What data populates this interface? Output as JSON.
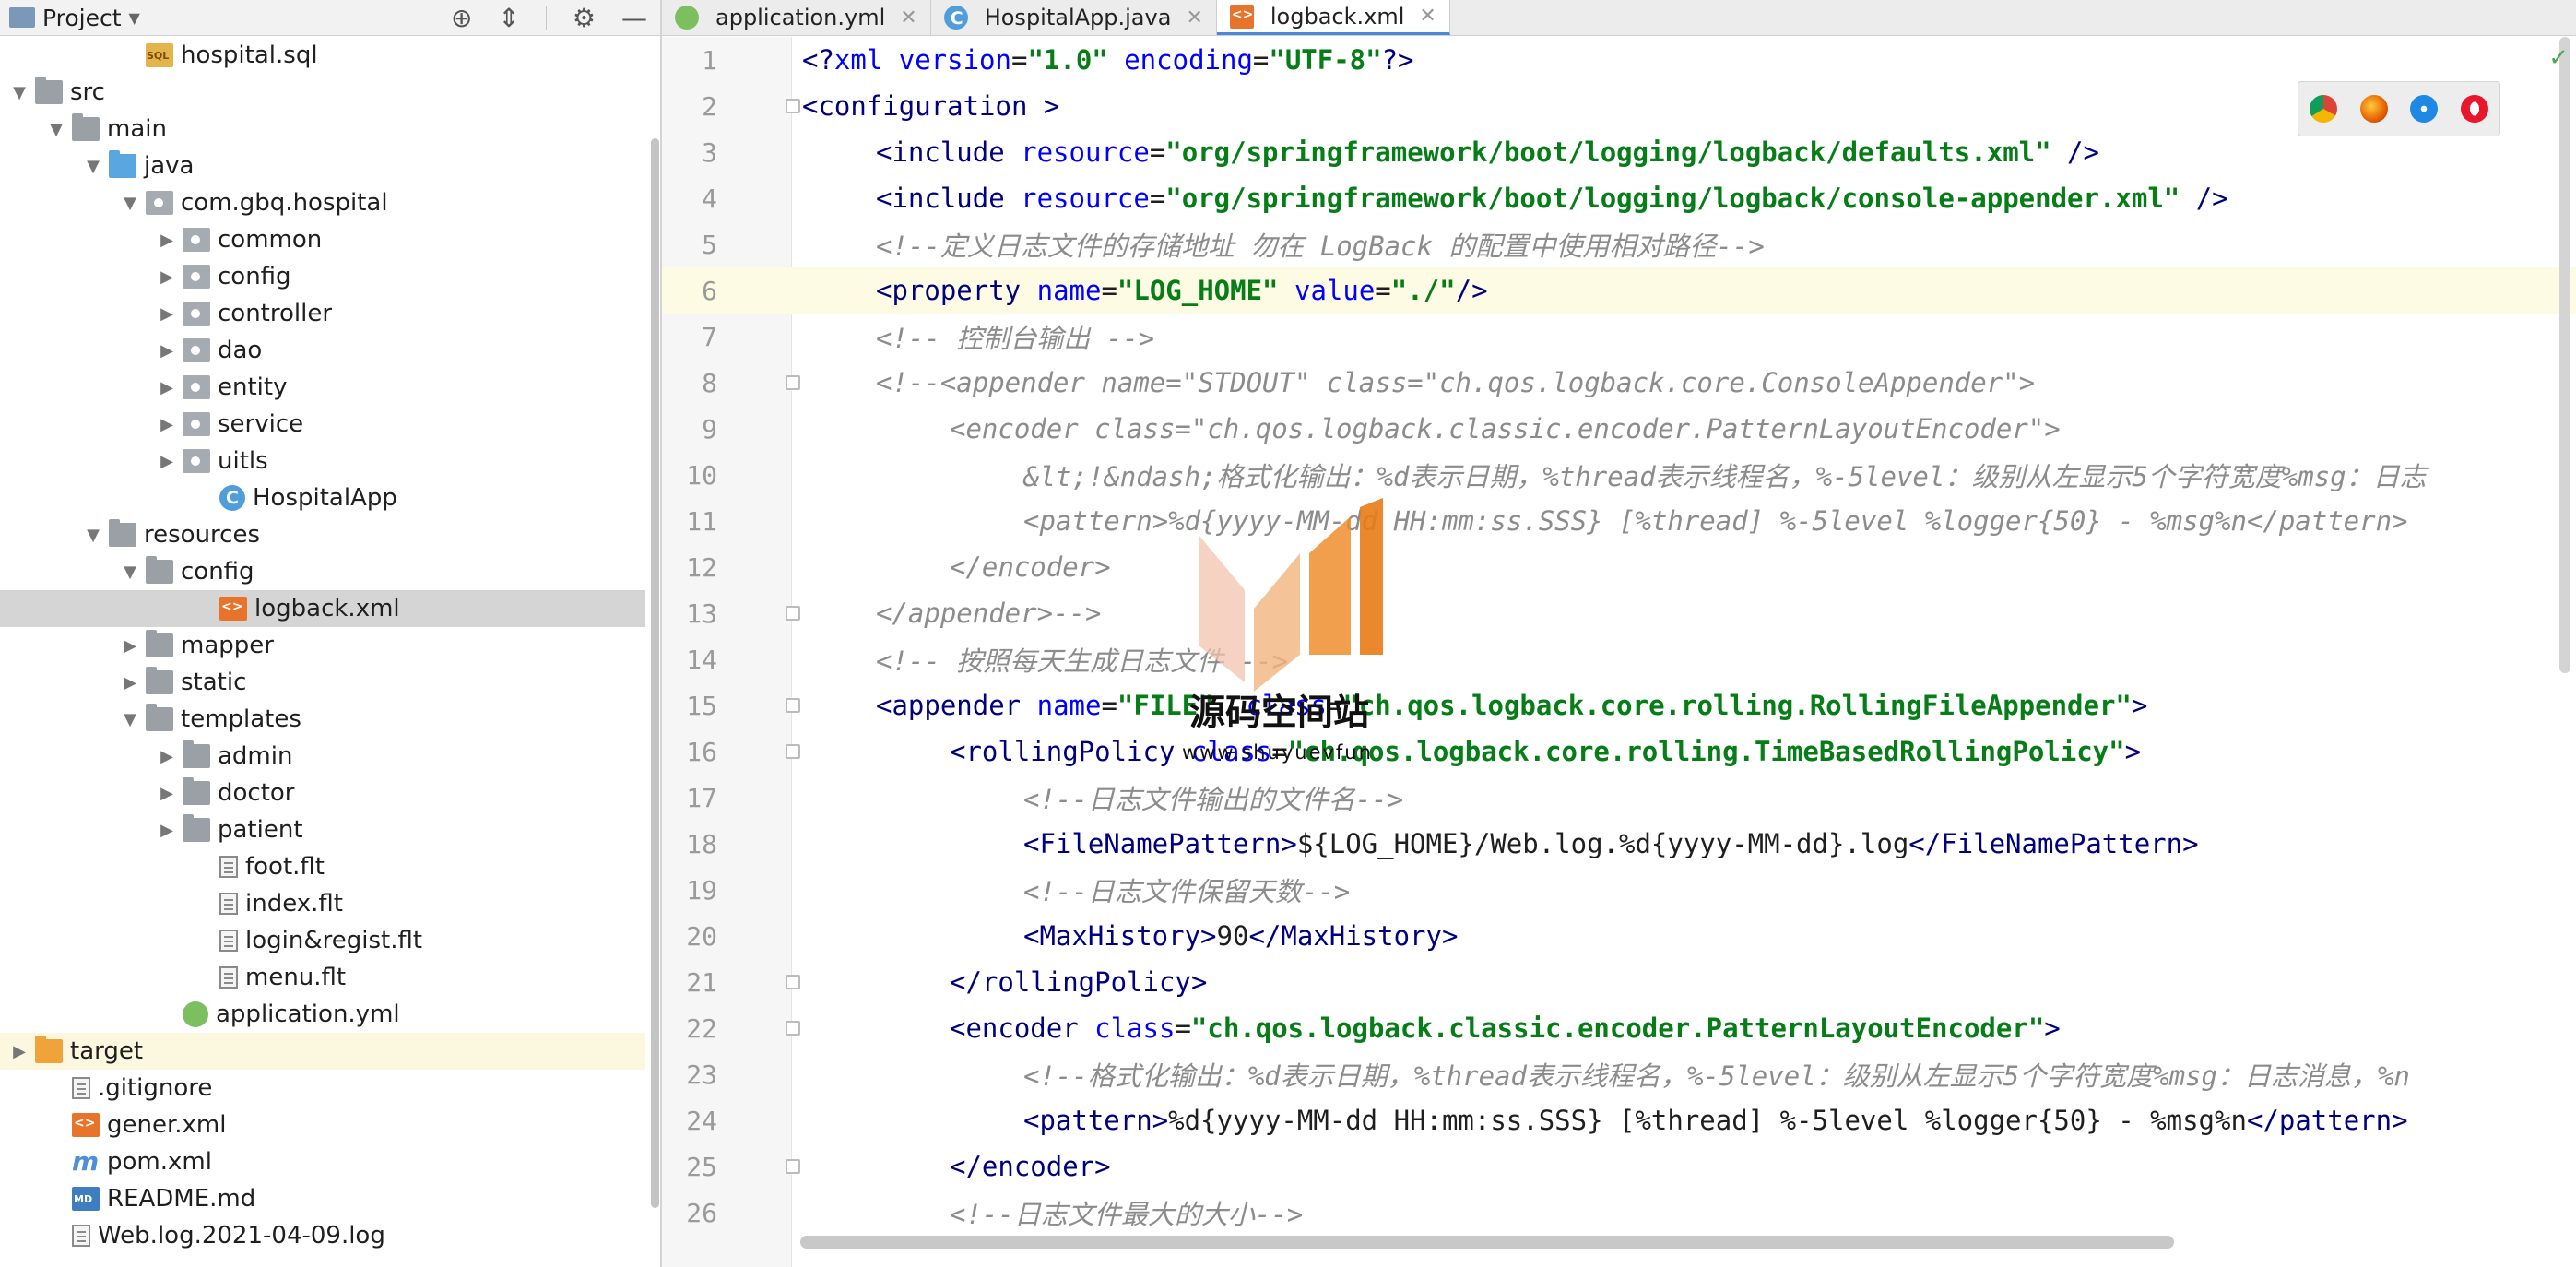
{
  "project_panel": {
    "title": "Project",
    "tools": {
      "globe": "globe-icon",
      "collapse": "collapse-icon",
      "gear": "gear-icon",
      "minimize": "minimize-icon"
    }
  },
  "tree": [
    {
      "label": "hospital.sql",
      "icon": "sql",
      "depth": 4,
      "arrow": ""
    },
    {
      "label": "src",
      "icon": "folder",
      "depth": 1,
      "arrow": "▼"
    },
    {
      "label": "main",
      "icon": "folder",
      "depth": 2,
      "arrow": "▼"
    },
    {
      "label": "java",
      "icon": "folder-blue",
      "depth": 3,
      "arrow": "▼"
    },
    {
      "label": "com.gbq.hospital",
      "icon": "pkg",
      "depth": 4,
      "arrow": "▼"
    },
    {
      "label": "common",
      "icon": "pkg",
      "depth": 5,
      "arrow": "▶"
    },
    {
      "label": "config",
      "icon": "pkg",
      "depth": 5,
      "arrow": "▶"
    },
    {
      "label": "controller",
      "icon": "pkg",
      "depth": 5,
      "arrow": "▶"
    },
    {
      "label": "dao",
      "icon": "pkg",
      "depth": 5,
      "arrow": "▶"
    },
    {
      "label": "entity",
      "icon": "pkg",
      "depth": 5,
      "arrow": "▶"
    },
    {
      "label": "service",
      "icon": "pkg",
      "depth": 5,
      "arrow": "▶"
    },
    {
      "label": "uitls",
      "icon": "pkg",
      "depth": 5,
      "arrow": "▶"
    },
    {
      "label": "HospitalApp",
      "icon": "java",
      "depth": 6,
      "arrow": ""
    },
    {
      "label": "resources",
      "icon": "folder",
      "depth": 3,
      "arrow": "▼"
    },
    {
      "label": "config",
      "icon": "folder",
      "depth": 4,
      "arrow": "▼"
    },
    {
      "label": "logback.xml",
      "icon": "xml",
      "depth": 6,
      "arrow": "",
      "selected": true
    },
    {
      "label": "mapper",
      "icon": "folder",
      "depth": 4,
      "arrow": "▶"
    },
    {
      "label": "static",
      "icon": "folder",
      "depth": 4,
      "arrow": "▶"
    },
    {
      "label": "templates",
      "icon": "folder",
      "depth": 4,
      "arrow": "▼"
    },
    {
      "label": "admin",
      "icon": "folder",
      "depth": 5,
      "arrow": "▶"
    },
    {
      "label": "doctor",
      "icon": "folder",
      "depth": 5,
      "arrow": "▶"
    },
    {
      "label": "patient",
      "icon": "folder",
      "depth": 5,
      "arrow": "▶"
    },
    {
      "label": "foot.flt",
      "icon": "file",
      "depth": 6,
      "arrow": ""
    },
    {
      "label": "index.flt",
      "icon": "file",
      "depth": 6,
      "arrow": ""
    },
    {
      "label": "login&regist.flt",
      "icon": "file",
      "depth": 6,
      "arrow": ""
    },
    {
      "label": "menu.flt",
      "icon": "file",
      "depth": 6,
      "arrow": ""
    },
    {
      "label": "application.yml",
      "icon": "yml",
      "depth": 5,
      "arrow": ""
    },
    {
      "label": "target",
      "icon": "folder-orange",
      "depth": 1,
      "arrow": "▶",
      "highlight": true
    },
    {
      "label": ".gitignore",
      "icon": "file",
      "depth": 2,
      "arrow": ""
    },
    {
      "label": "gener.xml",
      "icon": "xml",
      "depth": 2,
      "arrow": ""
    },
    {
      "label": "pom.xml",
      "icon": "maven",
      "depth": 2,
      "arrow": ""
    },
    {
      "label": "README.md",
      "icon": "md",
      "depth": 2,
      "arrow": ""
    },
    {
      "label": "Web.log.2021-04-09.log",
      "icon": "file",
      "depth": 2,
      "arrow": ""
    }
  ],
  "tabs": [
    {
      "label": "application.yml",
      "icon": "yml",
      "active": false
    },
    {
      "label": "HospitalApp.java",
      "icon": "java",
      "active": false
    },
    {
      "label": "logback.xml",
      "icon": "xml",
      "active": true
    }
  ],
  "editor": {
    "current_line": 6,
    "lines": [
      {
        "n": "1",
        "indent": 0,
        "fold": false,
        "parts": [
          [
            "tag",
            "<?"
          ],
          [
            "attr",
            "xml version"
          ],
          [
            "plain",
            "="
          ],
          [
            "val",
            "\"1.0\""
          ],
          [
            "attr",
            " encoding"
          ],
          [
            "plain",
            "="
          ],
          [
            "val",
            "\"UTF-8\""
          ],
          [
            "tag",
            "?>"
          ]
        ]
      },
      {
        "n": "2",
        "indent": 0,
        "fold": true,
        "parts": [
          [
            "tag",
            "<configuration "
          ],
          [
            "tag",
            ">"
          ]
        ]
      },
      {
        "n": "3",
        "indent": 1,
        "fold": false,
        "parts": [
          [
            "tag",
            "<include "
          ],
          [
            "attr",
            "resource"
          ],
          [
            "plain",
            "="
          ],
          [
            "val",
            "\"org/springframework/boot/logging/logback/defaults.xml\""
          ],
          [
            "tag",
            " />"
          ]
        ]
      },
      {
        "n": "4",
        "indent": 1,
        "fold": false,
        "parts": [
          [
            "tag",
            "<include "
          ],
          [
            "attr",
            "resource"
          ],
          [
            "plain",
            "="
          ],
          [
            "val",
            "\"org/springframework/boot/logging/logback/console-appender.xml\""
          ],
          [
            "tag",
            " />"
          ]
        ]
      },
      {
        "n": "5",
        "indent": 1,
        "fold": false,
        "parts": [
          [
            "cmt",
            "<!--定义日志文件的存储地址 勿在 LogBack 的配置中使用相对路径-->"
          ]
        ]
      },
      {
        "n": "6",
        "indent": 1,
        "fold": false,
        "parts": [
          [
            "tag",
            "<property "
          ],
          [
            "attr",
            "name"
          ],
          [
            "plain",
            "="
          ],
          [
            "val",
            "\"LOG_HOME\""
          ],
          [
            "attr",
            " value"
          ],
          [
            "plain",
            "="
          ],
          [
            "val",
            "\"./\""
          ],
          [
            "tag",
            "/>"
          ]
        ]
      },
      {
        "n": "7",
        "indent": 1,
        "fold": false,
        "parts": [
          [
            "cmt",
            "<!-- 控制台输出 -->"
          ]
        ]
      },
      {
        "n": "8",
        "indent": 1,
        "fold": true,
        "parts": [
          [
            "cmt",
            "<!--<appender name=\"STDOUT\" class=\"ch.qos.logback.core.ConsoleAppender\">"
          ]
        ]
      },
      {
        "n": "9",
        "indent": 2,
        "fold": false,
        "parts": [
          [
            "cmt",
            "<encoder class=\"ch.qos.logback.classic.encoder.PatternLayoutEncoder\">"
          ]
        ]
      },
      {
        "n": "10",
        "indent": 3,
        "fold": false,
        "parts": [
          [
            "cmt",
            "&lt;!&ndash;格式化输出：%d表示日期，%thread表示线程名，%-5level：级别从左显示5个字符宽度%msg：日志"
          ]
        ]
      },
      {
        "n": "11",
        "indent": 3,
        "fold": false,
        "parts": [
          [
            "cmt",
            "<pattern>%d{yyyy-MM-dd HH:mm:ss.SSS} [%thread] %-5level %logger{50} - %msg%n</pattern>"
          ]
        ]
      },
      {
        "n": "12",
        "indent": 2,
        "fold": false,
        "parts": [
          [
            "cmt",
            "</encoder>"
          ]
        ]
      },
      {
        "n": "13",
        "indent": 1,
        "fold": true,
        "parts": [
          [
            "cmt",
            "</appender>-->"
          ]
        ]
      },
      {
        "n": "14",
        "indent": 1,
        "fold": false,
        "parts": [
          [
            "cmt",
            "<!-- 按照每天生成日志文件 -->"
          ]
        ]
      },
      {
        "n": "15",
        "indent": 1,
        "fold": true,
        "parts": [
          [
            "tag",
            "<appender "
          ],
          [
            "attr",
            "name"
          ],
          [
            "plain",
            "="
          ],
          [
            "val",
            "\"FILE\""
          ],
          [
            "attr",
            "  class"
          ],
          [
            "plain",
            "="
          ],
          [
            "val",
            "\"ch.qos.logback.core.rolling.RollingFileAppender\""
          ],
          [
            "tag",
            ">"
          ]
        ]
      },
      {
        "n": "16",
        "indent": 2,
        "fold": true,
        "parts": [
          [
            "tag",
            "<rollingPolicy "
          ],
          [
            "attr",
            "class"
          ],
          [
            "plain",
            "="
          ],
          [
            "val",
            "\"ch.qos.logback.core.rolling.TimeBasedRollingPolicy\""
          ],
          [
            "tag",
            ">"
          ]
        ]
      },
      {
        "n": "17",
        "indent": 3,
        "fold": false,
        "parts": [
          [
            "cmt",
            "<!--日志文件输出的文件名-->"
          ]
        ]
      },
      {
        "n": "18",
        "indent": 3,
        "fold": false,
        "parts": [
          [
            "tag",
            "<FileNamePattern>"
          ],
          [
            "plain",
            "${LOG_HOME}/Web.log.%d{yyyy-MM-dd}.log"
          ],
          [
            "tag",
            "</FileNamePattern>"
          ]
        ]
      },
      {
        "n": "19",
        "indent": 3,
        "fold": false,
        "parts": [
          [
            "cmt",
            "<!--日志文件保留天数-->"
          ]
        ]
      },
      {
        "n": "20",
        "indent": 3,
        "fold": false,
        "parts": [
          [
            "tag",
            "<MaxHistory>"
          ],
          [
            "plain",
            "90"
          ],
          [
            "tag",
            "</MaxHistory>"
          ]
        ]
      },
      {
        "n": "21",
        "indent": 2,
        "fold": true,
        "parts": [
          [
            "tag",
            "</rollingPolicy>"
          ]
        ]
      },
      {
        "n": "22",
        "indent": 2,
        "fold": true,
        "parts": [
          [
            "tag",
            "<encoder "
          ],
          [
            "attr",
            "class"
          ],
          [
            "plain",
            "="
          ],
          [
            "val",
            "\"ch.qos.logback.classic.encoder.PatternLayoutEncoder\""
          ],
          [
            "tag",
            ">"
          ]
        ]
      },
      {
        "n": "23",
        "indent": 3,
        "fold": false,
        "parts": [
          [
            "cmt",
            "<!--格式化输出：%d表示日期，%thread表示线程名，%-5level：级别从左显示5个字符宽度%msg：日志消息，%n"
          ]
        ]
      },
      {
        "n": "24",
        "indent": 3,
        "fold": false,
        "parts": [
          [
            "tag",
            "<pattern>"
          ],
          [
            "plain",
            "%d{yyyy-MM-dd HH:mm:ss.SSS} [%thread] %-5level %logger{50} - %msg%n"
          ],
          [
            "tag",
            "</pattern>"
          ]
        ]
      },
      {
        "n": "25",
        "indent": 2,
        "fold": true,
        "parts": [
          [
            "tag",
            "</encoder>"
          ]
        ]
      },
      {
        "n": "26",
        "indent": 2,
        "fold": false,
        "parts": [
          [
            "cmt",
            "<!--日志文件最大的大小-->"
          ]
        ]
      }
    ]
  },
  "browser_icons": [
    "chrome-icon",
    "firefox-icon",
    "safari-icon",
    "opera-icon"
  ],
  "watermark": {
    "title": "源码空间站",
    "subtitle": "www.shuyuevfun"
  },
  "colors": {
    "tag": "#000080",
    "attr": "#0000ff",
    "value": "#067d17",
    "comment": "#8c8c8c",
    "selection": "#d5d5d5",
    "accent": "#4a88d9"
  }
}
